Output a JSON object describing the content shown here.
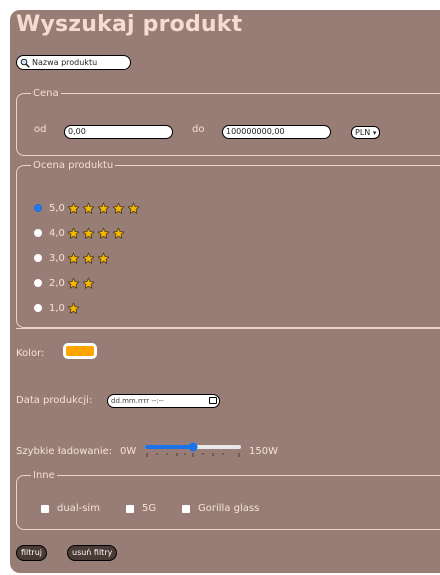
{
  "title": "Wyszukaj produkt",
  "search": {
    "placeholder": "Nazwa produktu"
  },
  "price": {
    "legend": "Cena",
    "from_label": "od",
    "from_value": "0,00",
    "to_label": "do",
    "to_value": "100000000,00",
    "currency": "PLN"
  },
  "rating": {
    "legend": "Ocena produktu",
    "options": [
      {
        "label": "5,0",
        "stars": 5,
        "checked": true
      },
      {
        "label": "4,0",
        "stars": 4,
        "checked": false
      },
      {
        "label": "3,0",
        "stars": 3,
        "checked": false
      },
      {
        "label": "2,0",
        "stars": 2,
        "checked": false
      },
      {
        "label": "1,0",
        "stars": 1,
        "checked": false
      }
    ]
  },
  "color": {
    "label": "Kolor:",
    "value": "#ffa500"
  },
  "date": {
    "label": "Data produkcji:",
    "placeholder": "dd.mm.rrrr --:--"
  },
  "charging": {
    "label": "Szybkie ładowanie:",
    "min_label": "0W",
    "max_label": "150W",
    "value_fraction": 0.5
  },
  "other": {
    "legend": "Inne",
    "options": [
      "dual-sim",
      "5G",
      "Gorilla glass"
    ]
  },
  "buttons": {
    "filter": "filtruj",
    "clear": "usuń filtry"
  },
  "colors": {
    "panel_bg": "#977d75",
    "star": "#f5b800",
    "accent": "#1a73e8"
  }
}
